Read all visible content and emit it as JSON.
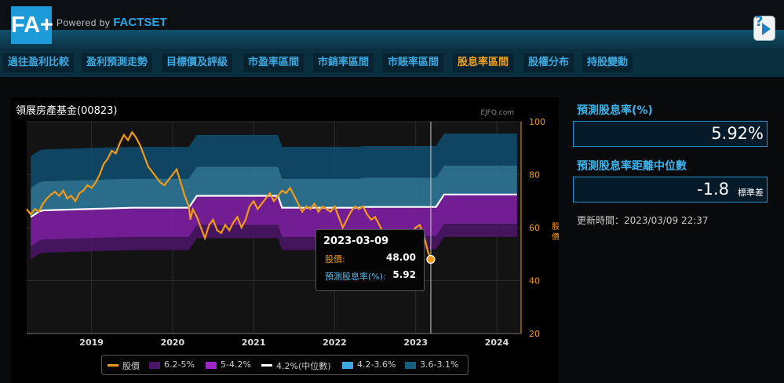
{
  "header": {
    "logo_text": "FA+",
    "powered_prefix": "Powered by",
    "powered_brand": "FACTSET",
    "help_label": "?"
  },
  "nav": {
    "items": [
      {
        "label": "過往盈利比較"
      },
      {
        "label": "盈利預測走勢"
      },
      {
        "label": "目標價及評級"
      },
      {
        "label": "市盈率區間"
      },
      {
        "label": "市銷率區間"
      },
      {
        "label": "市賬率區間"
      },
      {
        "label": "股息率區間",
        "active": true
      },
      {
        "label": "股權分布"
      },
      {
        "label": "持股變動"
      }
    ]
  },
  "colors": {
    "accent_orange": "#f2a11c",
    "accent_blue": "#3fb4ec",
    "band_6_2_5": "#4a1565",
    "band_5_4_2": "#7d1fa3",
    "band_4_2_3_6": "#2e7797",
    "band_3_6_3_1": "#0f4b6b",
    "median": "#ffffff",
    "price_line": "#f29a17"
  },
  "chart_data": {
    "type": "line",
    "title": "領展房產基金(00823)",
    "watermark": "EJFQ.com",
    "ylabel": "股價",
    "ylim": [
      20,
      100
    ],
    "yticks": [
      "20",
      "40",
      "60",
      "80",
      "100"
    ],
    "xlim": [
      2018.2,
      2024.3
    ],
    "xticks": [
      {
        "value": 2019.0,
        "label": "2019"
      },
      {
        "value": 2020.0,
        "label": "2020"
      },
      {
        "value": 2021.0,
        "label": "2021"
      },
      {
        "value": 2022.0,
        "label": "2022"
      },
      {
        "value": 2023.0,
        "label": "2023"
      },
      {
        "value": 2024.0,
        "label": "2024"
      }
    ],
    "band_steps": [
      {
        "x": 2018.25,
        "median": 64.0
      },
      {
        "x": 2018.35,
        "median": 66.0
      },
      {
        "x": 2018.4,
        "median": 66.5
      },
      {
        "x": 2019.5,
        "median": 67.5
      },
      {
        "x": 2020.2,
        "median": 67.5
      },
      {
        "x": 2020.3,
        "median": 72.0
      },
      {
        "x": 2021.3,
        "median": 72.0
      },
      {
        "x": 2021.35,
        "median": 67.5
      },
      {
        "x": 2022.3,
        "median": 67.5
      },
      {
        "x": 2022.35,
        "median": 67.8
      },
      {
        "x": 2023.25,
        "median": 67.8
      },
      {
        "x": 2023.35,
        "median": 72.5
      },
      {
        "x": 2024.25,
        "median": 72.5
      }
    ],
    "series": [
      {
        "name": "股價",
        "points": [
          [
            2018.2,
            67
          ],
          [
            2018.25,
            65
          ],
          [
            2018.3,
            67
          ],
          [
            2018.35,
            66
          ],
          [
            2018.4,
            69
          ],
          [
            2018.45,
            71
          ],
          [
            2018.5,
            72.5
          ],
          [
            2018.55,
            73.5
          ],
          [
            2018.6,
            72
          ],
          [
            2018.65,
            74
          ],
          [
            2018.7,
            71
          ],
          [
            2018.75,
            72
          ],
          [
            2018.8,
            70
          ],
          [
            2018.85,
            73
          ],
          [
            2018.9,
            74
          ],
          [
            2018.95,
            76
          ],
          [
            2019.0,
            75
          ],
          [
            2019.05,
            77
          ],
          [
            2019.1,
            80
          ],
          [
            2019.15,
            84
          ],
          [
            2019.2,
            86
          ],
          [
            2019.25,
            89
          ],
          [
            2019.3,
            88
          ],
          [
            2019.35,
            92
          ],
          [
            2019.4,
            95
          ],
          [
            2019.45,
            93
          ],
          [
            2019.5,
            96
          ],
          [
            2019.55,
            94
          ],
          [
            2019.6,
            91
          ],
          [
            2019.65,
            87
          ],
          [
            2019.7,
            83
          ],
          [
            2019.75,
            81
          ],
          [
            2019.8,
            79
          ],
          [
            2019.85,
            77
          ],
          [
            2019.9,
            76
          ],
          [
            2019.95,
            78
          ],
          [
            2020.0,
            80
          ],
          [
            2020.05,
            82
          ],
          [
            2020.1,
            77
          ],
          [
            2020.15,
            72
          ],
          [
            2020.2,
            68
          ],
          [
            2020.22,
            63
          ],
          [
            2020.25,
            67
          ],
          [
            2020.3,
            64
          ],
          [
            2020.35,
            60
          ],
          [
            2020.4,
            56
          ],
          [
            2020.45,
            61
          ],
          [
            2020.5,
            63
          ],
          [
            2020.55,
            59
          ],
          [
            2020.6,
            58
          ],
          [
            2020.65,
            61
          ],
          [
            2020.7,
            59
          ],
          [
            2020.75,
            62
          ],
          [
            2020.8,
            64
          ],
          [
            2020.85,
            60
          ],
          [
            2020.9,
            63
          ],
          [
            2020.95,
            68
          ],
          [
            2021.0,
            70
          ],
          [
            2021.05,
            67
          ],
          [
            2021.1,
            69
          ],
          [
            2021.15,
            71
          ],
          [
            2021.2,
            73
          ],
          [
            2021.25,
            70
          ],
          [
            2021.3,
            72
          ],
          [
            2021.35,
            74
          ],
          [
            2021.4,
            73
          ],
          [
            2021.45,
            75
          ],
          [
            2021.5,
            72
          ],
          [
            2021.55,
            69
          ],
          [
            2021.6,
            66
          ],
          [
            2021.65,
            68
          ],
          [
            2021.7,
            67
          ],
          [
            2021.75,
            69
          ],
          [
            2021.8,
            66
          ],
          [
            2021.85,
            68
          ],
          [
            2021.9,
            67
          ],
          [
            2021.95,
            66
          ],
          [
            2022.0,
            68
          ],
          [
            2022.05,
            64
          ],
          [
            2022.1,
            60
          ],
          [
            2022.15,
            63
          ],
          [
            2022.2,
            66
          ],
          [
            2022.25,
            68
          ],
          [
            2022.3,
            67
          ],
          [
            2022.35,
            68
          ],
          [
            2022.4,
            65
          ],
          [
            2022.45,
            63
          ],
          [
            2022.5,
            64
          ],
          [
            2022.55,
            61
          ],
          [
            2022.6,
            58
          ],
          [
            2022.65,
            56
          ],
          [
            2022.7,
            53
          ],
          [
            2022.75,
            55
          ],
          [
            2022.8,
            54
          ],
          [
            2022.85,
            57
          ],
          [
            2022.9,
            55
          ],
          [
            2022.95,
            58
          ],
          [
            2023.0,
            60
          ],
          [
            2023.05,
            61
          ],
          [
            2023.1,
            57
          ],
          [
            2023.15,
            51
          ],
          [
            2023.186,
            48
          ]
        ]
      }
    ],
    "tooltip": {
      "date": "2023-03-09",
      "x": 2023.186,
      "price_label": "股價:",
      "price_value": "48.00",
      "yield_label": "預測股息率(%):",
      "yield_value": "5.92"
    },
    "legend": [
      {
        "label": "股價",
        "kind": "line",
        "color": "#f29a17"
      },
      {
        "label": "6.2-5%",
        "kind": "box",
        "color": "#4a1565"
      },
      {
        "label": "5-4.2%",
        "kind": "box",
        "color": "#9d27c9"
      },
      {
        "label": "4.2%(中位數)",
        "kind": "line",
        "color": "#ffffff"
      },
      {
        "label": "4.2-3.6%",
        "kind": "box",
        "color": "#40a9df"
      },
      {
        "label": "3.6-3.1%",
        "kind": "box",
        "color": "#13607f"
      }
    ]
  },
  "right_panel": {
    "yield_title": "預測股息率(%)",
    "yield_value": "5.92%",
    "deviation_title": "預測股息率距離中位數",
    "deviation_value": "-1.8",
    "deviation_unit": "標準差",
    "updated_text": "更新時間：2023/03/09 22:37"
  }
}
